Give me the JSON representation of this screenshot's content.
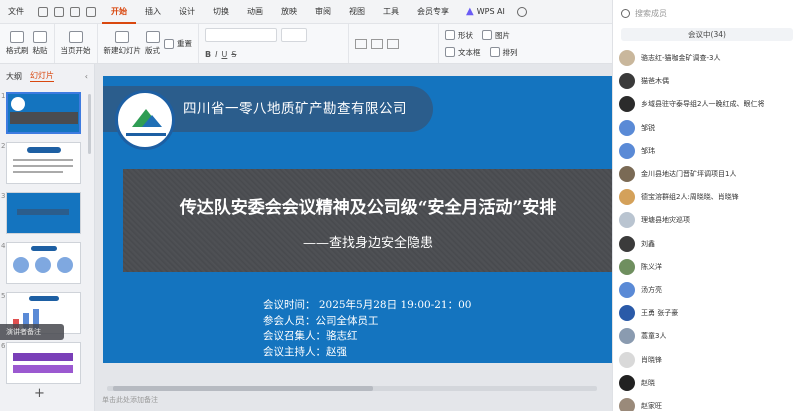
{
  "menubar": {
    "file": "文件",
    "tabs": [
      "开始",
      "插入",
      "设计",
      "切换",
      "动画",
      "放映",
      "审阅",
      "视图",
      "工具",
      "会员专享"
    ],
    "active_tab": "开始",
    "ai_label": "WPS AI"
  },
  "toolbar": {
    "format_painter": "格式刷",
    "paste": "粘贴",
    "from_current": "当页开始",
    "new_slide": "新建幻灯片",
    "layout": "版式",
    "reset": "重置",
    "shape": "形状",
    "textbox": "文本框",
    "picture": "图片",
    "arrange": "排列"
  },
  "left_pane": {
    "tab_outline": "大纲",
    "tab_slides": "幻灯片",
    "slide_numbers": [
      "1",
      "2",
      "3",
      "4",
      "5",
      "6"
    ],
    "popup": "演讲者备注",
    "add": "+"
  },
  "slide": {
    "company": "四川省一零八地质矿产勘查有限公司",
    "title": "传达队安委会会议精神及公司级“安全月活动”安排",
    "subtitle": "——查找身边安全隐患",
    "info": [
      "会议时间：  2025年5月28日 19:00-21：00",
      "参会人员：公司全体员工",
      "会议召集人：骆志红",
      "会议主持人：赵强"
    ]
  },
  "notes_placeholder": "单击此处添加备注",
  "right_pane": {
    "search_placeholder": "搜索成员",
    "tab_label": "会议中(34)",
    "members": [
      {
        "name": "骆志红-猫咖金矿调查-3人",
        "color": "#c9b79c"
      },
      {
        "name": "猫爸木偶",
        "color": "#3a3a3a"
      },
      {
        "name": "乡域县驻守泰导组2人一晚红成、眼仁将",
        "color": "#2b2b2b"
      },
      {
        "name": "邹锐",
        "color": "#5a8ad6"
      },
      {
        "name": "邹玮",
        "color": "#5a8ad6"
      },
      {
        "name": "金川县地达门晋矿坪调项目1人",
        "color": "#7a6a55"
      },
      {
        "name": "德宝溶群组2人:周晓晓、肖晓锋",
        "color": "#d4a15a"
      },
      {
        "name": "理塘县地灾巡项",
        "color": "#b9c4d0"
      },
      {
        "name": "刘鑫",
        "color": "#3b3b3b"
      },
      {
        "name": "陈义洋",
        "color": "#6f8f5f"
      },
      {
        "name": "汤方亮",
        "color": "#5a8ad6"
      },
      {
        "name": "王勇 张子豪",
        "color": "#2a5aa8"
      },
      {
        "name": "蒿童3人",
        "color": "#8a9bb0"
      },
      {
        "name": "肖晓锋",
        "color": "#d9d9d9"
      },
      {
        "name": "赵晓",
        "color": "#222222"
      },
      {
        "name": "赵家旺",
        "color": "#9a8a7a"
      }
    ]
  }
}
